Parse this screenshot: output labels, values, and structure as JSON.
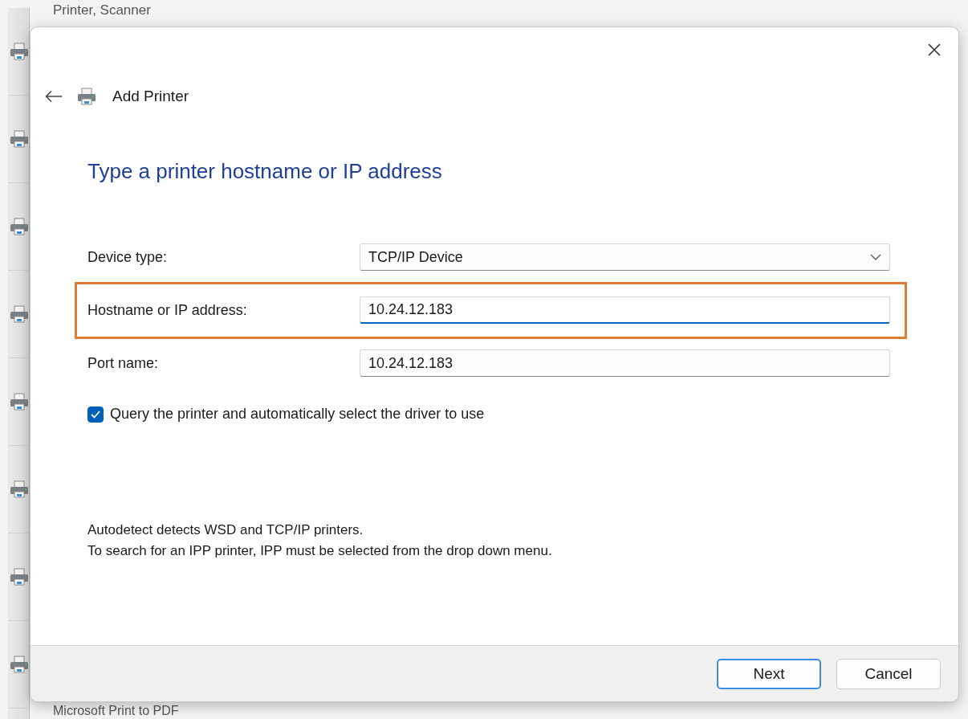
{
  "background": {
    "header_text": "Printer, Scanner",
    "footer_text": "Microsoft Print to PDF"
  },
  "dialog": {
    "title": "Add Printer",
    "heading": "Type a printer hostname or IP address",
    "fields": [
      {
        "kind": "dropdown",
        "label": "Device type:",
        "value": "TCP/IP Device",
        "focused": false,
        "highlighted": false
      },
      {
        "kind": "text",
        "label": "Hostname or IP address:",
        "value": "10.24.12.183",
        "focused": true,
        "highlighted": true
      },
      {
        "kind": "text",
        "label": "Port name:",
        "value": "10.24.12.183",
        "focused": false,
        "highlighted": false
      }
    ],
    "checkbox": {
      "label": "Query the printer and automatically select the driver to use",
      "checked": true
    },
    "notes": [
      "Autodetect detects WSD and TCP/IP printers.",
      "To search for an IPP printer, IPP must be selected from the drop down menu."
    ],
    "buttons": [
      {
        "label": "Next",
        "default": true
      },
      {
        "label": "Cancel",
        "default": false
      }
    ]
  }
}
